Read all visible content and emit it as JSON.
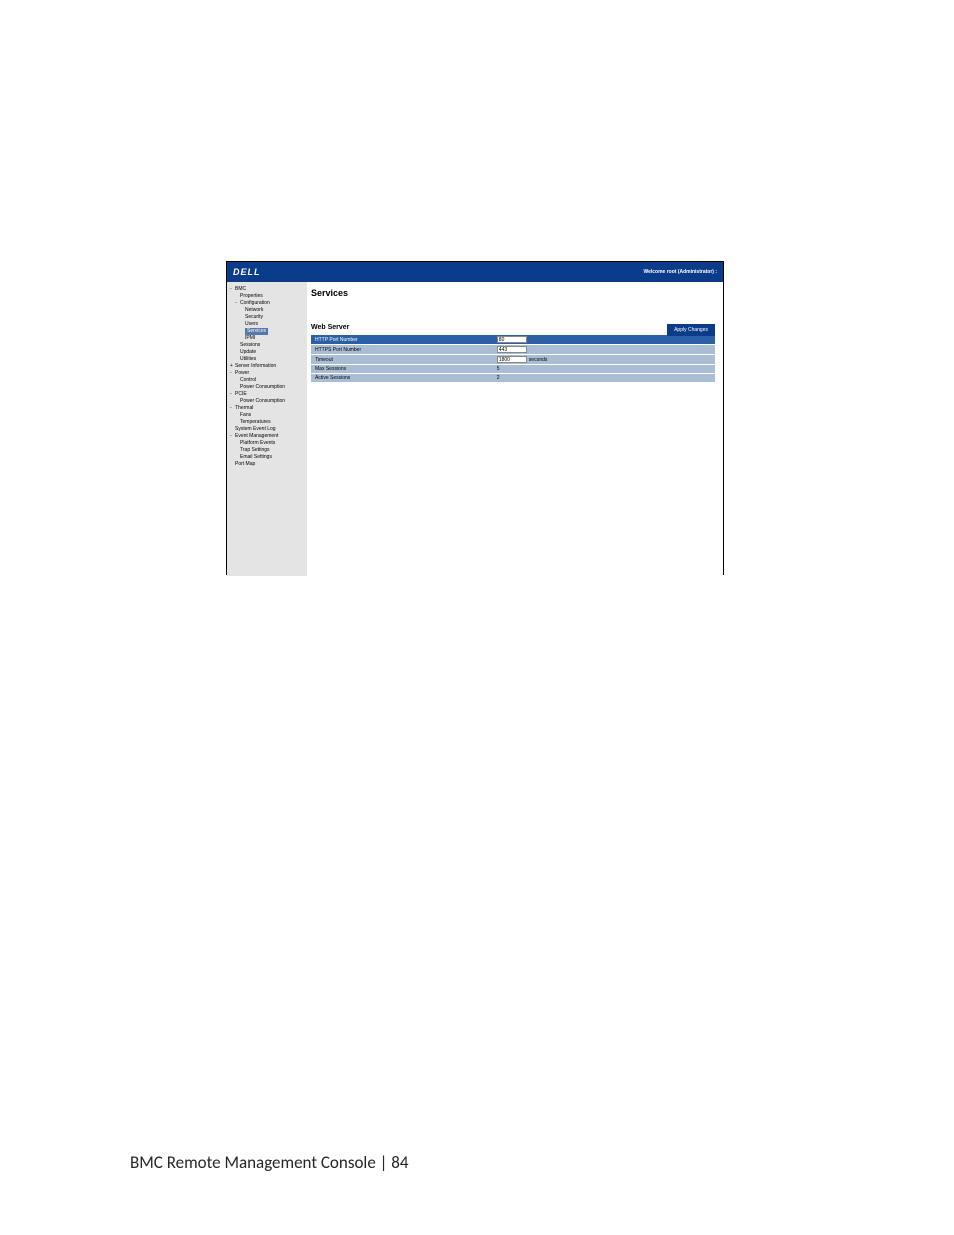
{
  "header": {
    "logo": "DELL",
    "welcome": "Welcome root (Administrator) :"
  },
  "sidebar": {
    "items": [
      {
        "label": "BMC",
        "level": 0,
        "exp": "-"
      },
      {
        "label": "Properties",
        "level": 1
      },
      {
        "label": "Configuration",
        "level": 1,
        "exp": "-"
      },
      {
        "label": "Network",
        "level": 2
      },
      {
        "label": "Security",
        "level": 2
      },
      {
        "label": "Users",
        "level": 2
      },
      {
        "label": "Services",
        "level": 2,
        "selected": true
      },
      {
        "label": "IPMI",
        "level": 2
      },
      {
        "label": "Sessions",
        "level": 1
      },
      {
        "label": "Update",
        "level": 1
      },
      {
        "label": "Utilities",
        "level": 1
      },
      {
        "label": "Server Information",
        "level": 0,
        "exp": "+"
      },
      {
        "label": "Power",
        "level": 0,
        "exp": "-"
      },
      {
        "label": "Control",
        "level": 1
      },
      {
        "label": "Power Consumption",
        "level": 1
      },
      {
        "label": "PCIE",
        "level": 0,
        "exp": "-"
      },
      {
        "label": "Power Consumption",
        "level": 1
      },
      {
        "label": "Thermal",
        "level": 0,
        "exp": "-"
      },
      {
        "label": "Fans",
        "level": 1
      },
      {
        "label": "Temperatures",
        "level": 1
      },
      {
        "label": "System Event Log",
        "level": 0
      },
      {
        "label": "Event Management",
        "level": 0,
        "exp": "-"
      },
      {
        "label": "Platform Events",
        "level": 1
      },
      {
        "label": "Trap Settings",
        "level": 1
      },
      {
        "label": "Email Settings",
        "level": 1
      },
      {
        "label": "Port Map",
        "level": 0
      }
    ]
  },
  "main": {
    "title": "Services",
    "apply_button": "Apply Changes",
    "section": "Web Server",
    "rows": [
      {
        "label": "HTTP Port Number",
        "value": "80",
        "input": true,
        "header": true
      },
      {
        "label": "HTTPS Port Number",
        "value": "443",
        "input": true
      },
      {
        "label": "Timeout",
        "value": "1800",
        "input": true,
        "unit": "seconds"
      },
      {
        "label": "Max Sessions",
        "value": "5"
      },
      {
        "label": "Active Sessions",
        "value": "2"
      }
    ]
  },
  "footer": {
    "text": "BMC Remote Management Console | 84"
  }
}
